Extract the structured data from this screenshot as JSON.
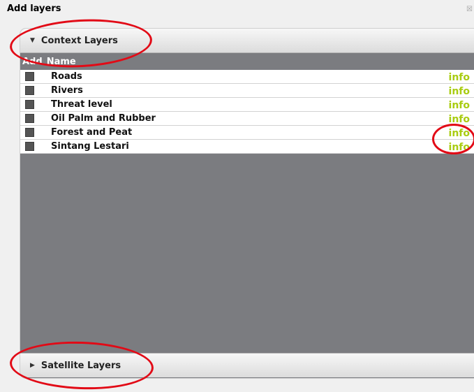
{
  "dialog": {
    "title": "Add layers"
  },
  "context_section": {
    "title": "Context Layers",
    "expanded": true
  },
  "satellite_section": {
    "title": "Satellite Layers",
    "expanded": false
  },
  "table": {
    "col_add": "Add",
    "col_name": "Name"
  },
  "layers": [
    {
      "name": "Roads",
      "info": "info"
    },
    {
      "name": "Rivers",
      "info": "info"
    },
    {
      "name": "Threat level",
      "info": "info"
    },
    {
      "name": "Oil Palm and Rubber",
      "info": "info"
    },
    {
      "name": "Forest and Peat",
      "info": "info"
    },
    {
      "name": "Sintang Lestari",
      "info": "info"
    }
  ],
  "colors": {
    "panel_bg": "#7b7c80",
    "info_link": "#a9cc11",
    "annotation": "#e20a16"
  }
}
